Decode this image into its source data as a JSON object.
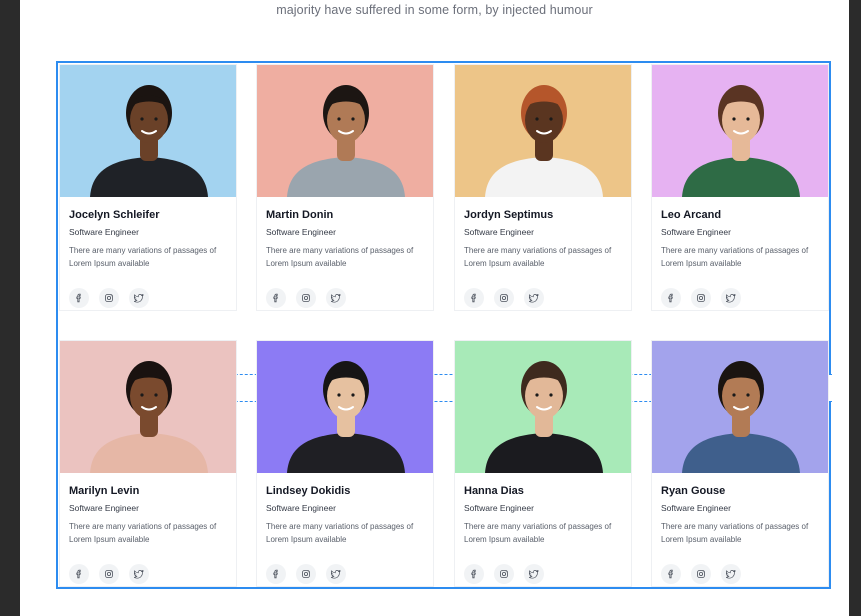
{
  "intro_text": "majority have suffered in some form, by injected humour",
  "social_icons": [
    "facebook-icon",
    "instagram-icon",
    "twitter-icon"
  ],
  "members": [
    {
      "name": "Jocelyn Schleifer",
      "role": "Software Engineer",
      "description": "There are many variations of passages of Lorem Ipsum available",
      "bg": "#a3d3f0",
      "skin": "#6a4128",
      "hair": "#1b1411",
      "shirt": "#1f2227"
    },
    {
      "name": "Martin Donin",
      "role": "Software Engineer",
      "description": "There are many variations of passages of Lorem Ipsum available",
      "bg": "#efaea1",
      "skin": "#b07a56",
      "hair": "#1c1613",
      "shirt": "#9aa5ae"
    },
    {
      "name": "Jordyn Septimus",
      "role": "Software Engineer",
      "description": "There are many variations of passages of Lorem Ipsum available",
      "bg": "#edc588",
      "skin": "#5a3520",
      "hair": "#b5562b",
      "shirt": "#f3f3f3"
    },
    {
      "name": "Leo Arcand",
      "role": "Software Engineer",
      "description": "There are many variations of passages of Lorem Ipsum available",
      "bg": "#e6b2f2",
      "skin": "#e6b998",
      "hair": "#5a3423",
      "shirt": "#2e6b45"
    },
    {
      "name": "Marilyn Levin",
      "role": "Software Engineer",
      "description": "There are many variations of passages of Lorem Ipsum available",
      "bg": "#ebc3c0",
      "skin": "#7a4a2e",
      "hair": "#1a1210",
      "shirt": "#e6b7a6"
    },
    {
      "name": "Lindsey Dokidis",
      "role": "Software Engineer",
      "description": "There are many variations of passages of Lorem Ipsum available",
      "bg": "#8c7bf4",
      "skin": "#e6c1a0",
      "hair": "#171515",
      "shirt": "#1f1f24"
    },
    {
      "name": "Hanna Dias",
      "role": "Software Engineer",
      "description": "There are many variations of passages of Lorem Ipsum available",
      "bg": "#a8eab8",
      "skin": "#e2b898",
      "hair": "#3e2a1e",
      "shirt": "#1b1b1f"
    },
    {
      "name": "Ryan Gouse",
      "role": "Software Engineer",
      "description": "There are many variations of passages of Lorem Ipsum available",
      "bg": "#a3a3ec",
      "skin": "#b27b55",
      "hair": "#1a1411",
      "shirt": "#3f5f8c"
    }
  ]
}
